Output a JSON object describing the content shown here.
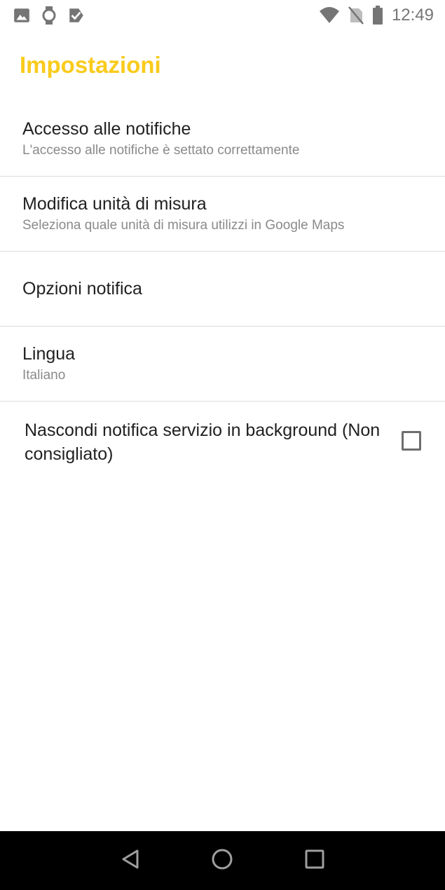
{
  "status_bar": {
    "time": "12:49",
    "left_icons": [
      "image-icon",
      "watch-icon",
      "checkmark-badge-icon"
    ],
    "right_icons": [
      "wifi-icon",
      "no-sim-icon",
      "battery-icon"
    ]
  },
  "page": {
    "title": "Impostazioni",
    "accent_color": "#F9CB1C"
  },
  "settings": [
    {
      "title": "Accesso alle notifiche",
      "subtitle": "L'accesso alle notifiche è settato correttamente"
    },
    {
      "title": "Modifica unità di misura",
      "subtitle": "Seleziona quale unità di misura utilizzi in Google Maps"
    },
    {
      "title": "Opzioni notifica",
      "subtitle": ""
    },
    {
      "title": "Lingua",
      "subtitle": "Italiano"
    }
  ],
  "checkbox_setting": {
    "label": "Nascondi notifica servizio in background (Non consigliato)",
    "checked": false
  },
  "nav_bar": {
    "buttons": [
      "back-icon",
      "home-icon",
      "recents-icon"
    ]
  }
}
